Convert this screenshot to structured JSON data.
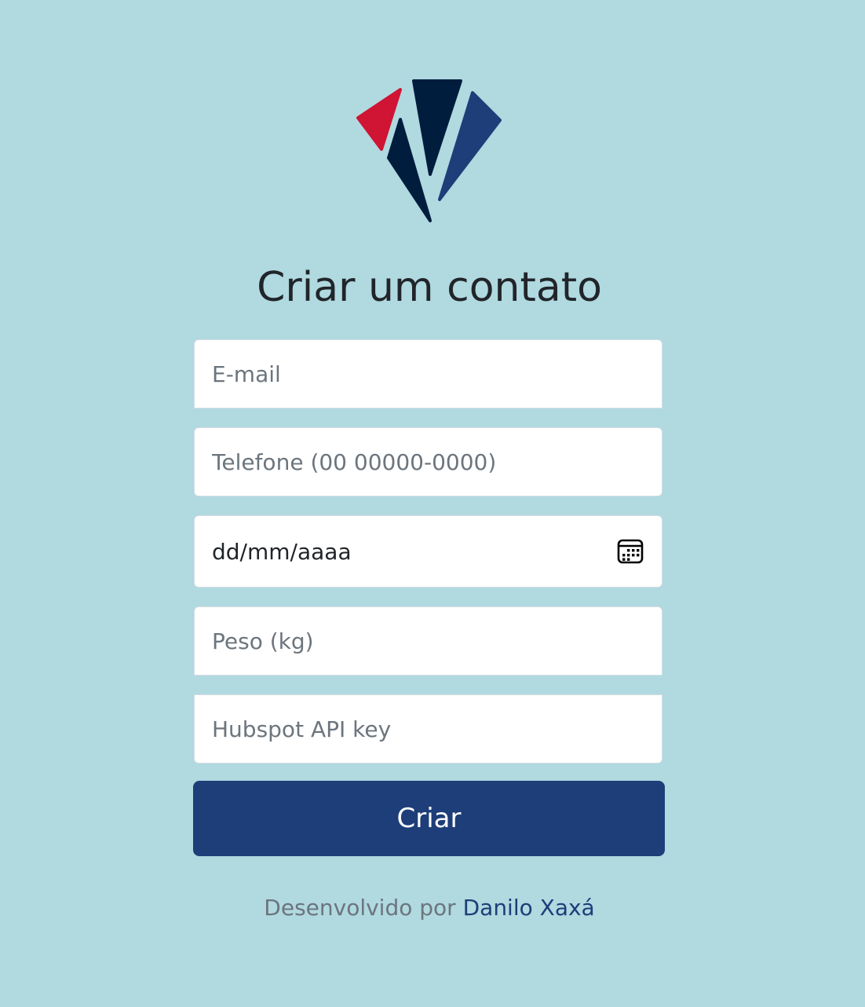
{
  "logo": {
    "icon": "diamond-logo-icon",
    "colors": {
      "red": "#d01433",
      "dark": "#001d3d",
      "blue": "#1d3e78"
    }
  },
  "title": "Criar um contato",
  "form": {
    "email_placeholder": "E-mail",
    "phone_placeholder": "Telefone (00 00000-0000)",
    "date_placeholder": "dd/mm/aaaa",
    "date_icon": "calendar-icon",
    "weight_placeholder": "Peso (kg)",
    "apikey_placeholder": "Hubspot API key",
    "submit_label": "Criar"
  },
  "footer": {
    "prefix": "Desenvolvido por",
    "author": "Danilo Xaxá"
  },
  "colors": {
    "background": "#b0d9e0",
    "primary": "#1d3e78",
    "text": "#212529",
    "muted": "#6c757d"
  }
}
